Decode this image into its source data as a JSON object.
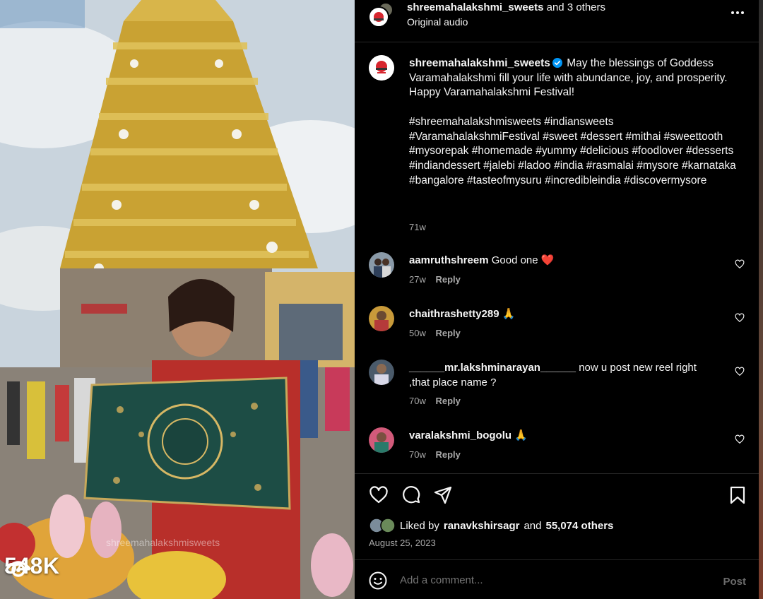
{
  "media": {
    "view_count": "548K",
    "watermark": "shreemahalakshmisweets",
    "icons": {
      "views": "eye-icon"
    }
  },
  "header": {
    "username": "shreemahalakshmi_sweets",
    "and_others": " and 3 others",
    "audio": "Original audio",
    "icons": {
      "more": "more-horizontal-icon"
    }
  },
  "caption": {
    "username": "shreemahalakshmi_sweets",
    "verified_icon": "verified-badge-icon",
    "lines": [
      "May the blessings of Goddess Varamahalakshmi fill your life with abundance, joy, and prosperity.",
      "Happy Varamahalakshmi Festival!",
      "",
      "#shreemahalakshmisweets #indiansweets #VaramahalakshmiFestival #sweet #dessert #mithai #sweettooth #mysorepak #homemade #yummy #delicious #foodlover #desserts #indiandessert #jalebi #ladoo #india #rasmalai #mysore #karnataka #bangalore #tasteofmysuru #incredibleindia #discovermysore"
    ],
    "time": "71w"
  },
  "comments": [
    {
      "user": "aamruthshreem",
      "text": "Good one ❤️",
      "time": "27w",
      "reply": "Reply"
    },
    {
      "user": "chaithrashetty289",
      "text": "🙏",
      "time": "50w",
      "reply": "Reply"
    },
    {
      "user": "______mr.lakshminarayan______",
      "text": "now u post new reel right ,that place name ?",
      "time": "70w",
      "reply": "Reply"
    },
    {
      "user": "varalakshmi_bogolu",
      "text": "🙏",
      "time": "70w",
      "reply": "Reply"
    }
  ],
  "actions": {
    "icons": [
      "heart-icon",
      "comment-icon",
      "share-icon",
      "bookmark-icon"
    ],
    "liked_prefix": "Liked by",
    "liked_user": "ranavkshirsagr",
    "liked_and": "and",
    "liked_others": "55,074 others",
    "date": "August 25, 2023"
  },
  "add_comment": {
    "placeholder": "Add a comment...",
    "post_label": "Post",
    "icons": {
      "emoji": "emoji-icon"
    }
  },
  "colors": {
    "background": "#000000",
    "text": "#f5f5f5",
    "muted": "#a8a8a8",
    "verified": "#0095f6",
    "heart_red": "#ed4956"
  }
}
